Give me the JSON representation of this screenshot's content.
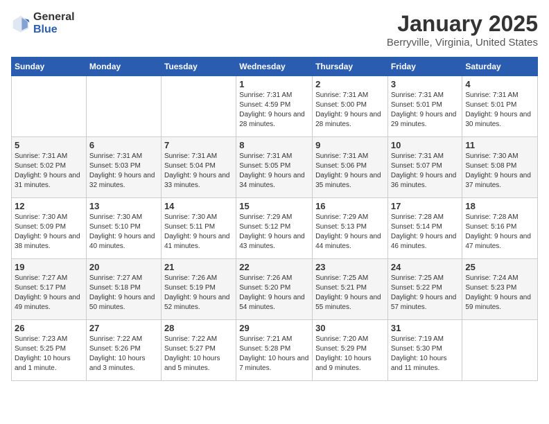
{
  "header": {
    "logo_general": "General",
    "logo_blue": "Blue",
    "title": "January 2025",
    "subtitle": "Berryville, Virginia, United States"
  },
  "weekdays": [
    "Sunday",
    "Monday",
    "Tuesday",
    "Wednesday",
    "Thursday",
    "Friday",
    "Saturday"
  ],
  "weeks": [
    [
      {
        "day": "",
        "info": ""
      },
      {
        "day": "",
        "info": ""
      },
      {
        "day": "",
        "info": ""
      },
      {
        "day": "1",
        "info": "Sunrise: 7:31 AM\nSunset: 4:59 PM\nDaylight: 9 hours and 28 minutes."
      },
      {
        "day": "2",
        "info": "Sunrise: 7:31 AM\nSunset: 5:00 PM\nDaylight: 9 hours and 28 minutes."
      },
      {
        "day": "3",
        "info": "Sunrise: 7:31 AM\nSunset: 5:01 PM\nDaylight: 9 hours and 29 minutes."
      },
      {
        "day": "4",
        "info": "Sunrise: 7:31 AM\nSunset: 5:01 PM\nDaylight: 9 hours and 30 minutes."
      }
    ],
    [
      {
        "day": "5",
        "info": "Sunrise: 7:31 AM\nSunset: 5:02 PM\nDaylight: 9 hours and 31 minutes."
      },
      {
        "day": "6",
        "info": "Sunrise: 7:31 AM\nSunset: 5:03 PM\nDaylight: 9 hours and 32 minutes."
      },
      {
        "day": "7",
        "info": "Sunrise: 7:31 AM\nSunset: 5:04 PM\nDaylight: 9 hours and 33 minutes."
      },
      {
        "day": "8",
        "info": "Sunrise: 7:31 AM\nSunset: 5:05 PM\nDaylight: 9 hours and 34 minutes."
      },
      {
        "day": "9",
        "info": "Sunrise: 7:31 AM\nSunset: 5:06 PM\nDaylight: 9 hours and 35 minutes."
      },
      {
        "day": "10",
        "info": "Sunrise: 7:31 AM\nSunset: 5:07 PM\nDaylight: 9 hours and 36 minutes."
      },
      {
        "day": "11",
        "info": "Sunrise: 7:30 AM\nSunset: 5:08 PM\nDaylight: 9 hours and 37 minutes."
      }
    ],
    [
      {
        "day": "12",
        "info": "Sunrise: 7:30 AM\nSunset: 5:09 PM\nDaylight: 9 hours and 38 minutes."
      },
      {
        "day": "13",
        "info": "Sunrise: 7:30 AM\nSunset: 5:10 PM\nDaylight: 9 hours and 40 minutes."
      },
      {
        "day": "14",
        "info": "Sunrise: 7:30 AM\nSunset: 5:11 PM\nDaylight: 9 hours and 41 minutes."
      },
      {
        "day": "15",
        "info": "Sunrise: 7:29 AM\nSunset: 5:12 PM\nDaylight: 9 hours and 43 minutes."
      },
      {
        "day": "16",
        "info": "Sunrise: 7:29 AM\nSunset: 5:13 PM\nDaylight: 9 hours and 44 minutes."
      },
      {
        "day": "17",
        "info": "Sunrise: 7:28 AM\nSunset: 5:14 PM\nDaylight: 9 hours and 46 minutes."
      },
      {
        "day": "18",
        "info": "Sunrise: 7:28 AM\nSunset: 5:16 PM\nDaylight: 9 hours and 47 minutes."
      }
    ],
    [
      {
        "day": "19",
        "info": "Sunrise: 7:27 AM\nSunset: 5:17 PM\nDaylight: 9 hours and 49 minutes."
      },
      {
        "day": "20",
        "info": "Sunrise: 7:27 AM\nSunset: 5:18 PM\nDaylight: 9 hours and 50 minutes."
      },
      {
        "day": "21",
        "info": "Sunrise: 7:26 AM\nSunset: 5:19 PM\nDaylight: 9 hours and 52 minutes."
      },
      {
        "day": "22",
        "info": "Sunrise: 7:26 AM\nSunset: 5:20 PM\nDaylight: 9 hours and 54 minutes."
      },
      {
        "day": "23",
        "info": "Sunrise: 7:25 AM\nSunset: 5:21 PM\nDaylight: 9 hours and 55 minutes."
      },
      {
        "day": "24",
        "info": "Sunrise: 7:25 AM\nSunset: 5:22 PM\nDaylight: 9 hours and 57 minutes."
      },
      {
        "day": "25",
        "info": "Sunrise: 7:24 AM\nSunset: 5:23 PM\nDaylight: 9 hours and 59 minutes."
      }
    ],
    [
      {
        "day": "26",
        "info": "Sunrise: 7:23 AM\nSunset: 5:25 PM\nDaylight: 10 hours and 1 minute."
      },
      {
        "day": "27",
        "info": "Sunrise: 7:22 AM\nSunset: 5:26 PM\nDaylight: 10 hours and 3 minutes."
      },
      {
        "day": "28",
        "info": "Sunrise: 7:22 AM\nSunset: 5:27 PM\nDaylight: 10 hours and 5 minutes."
      },
      {
        "day": "29",
        "info": "Sunrise: 7:21 AM\nSunset: 5:28 PM\nDaylight: 10 hours and 7 minutes."
      },
      {
        "day": "30",
        "info": "Sunrise: 7:20 AM\nSunset: 5:29 PM\nDaylight: 10 hours and 9 minutes."
      },
      {
        "day": "31",
        "info": "Sunrise: 7:19 AM\nSunset: 5:30 PM\nDaylight: 10 hours and 11 minutes."
      },
      {
        "day": "",
        "info": ""
      }
    ]
  ]
}
